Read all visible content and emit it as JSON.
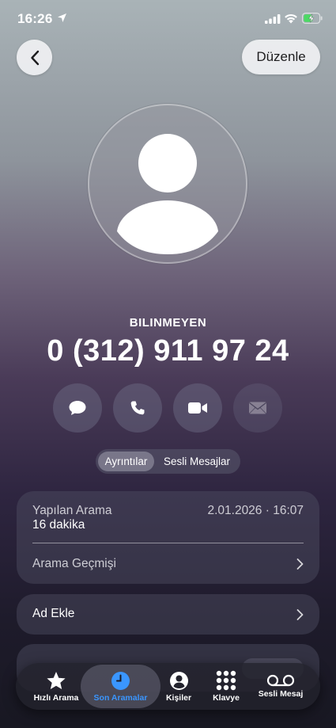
{
  "status_bar": {
    "time": "16:26"
  },
  "header": {
    "edit_label": "Düzenle"
  },
  "contact": {
    "label": "BILINMEYEN",
    "number": "0 (312) 911 97 24"
  },
  "segments": {
    "details": "Ayrıntılar",
    "voicemail": "Sesli Mesajlar",
    "selected": "details"
  },
  "call_card": {
    "type": "Yapılan Arama",
    "duration": "16 dakika",
    "date": "2.01.2026 · 16:07",
    "history_label": "Arama Geçmişi"
  },
  "add_name_label": "Ad Ekle",
  "tab_bar": {
    "tabs": [
      {
        "label": "Hızlı Arama",
        "icon": "star-icon"
      },
      {
        "label": "Son Aramalar",
        "icon": "clock-icon",
        "active": true
      },
      {
        "label": "Kişiler",
        "icon": "person-icon"
      },
      {
        "label": "Klavye",
        "icon": "keypad-icon"
      },
      {
        "label": "Sesli Mesaj",
        "icon": "voicemail-icon"
      }
    ]
  },
  "colors": {
    "accent": "#3a96ff"
  }
}
